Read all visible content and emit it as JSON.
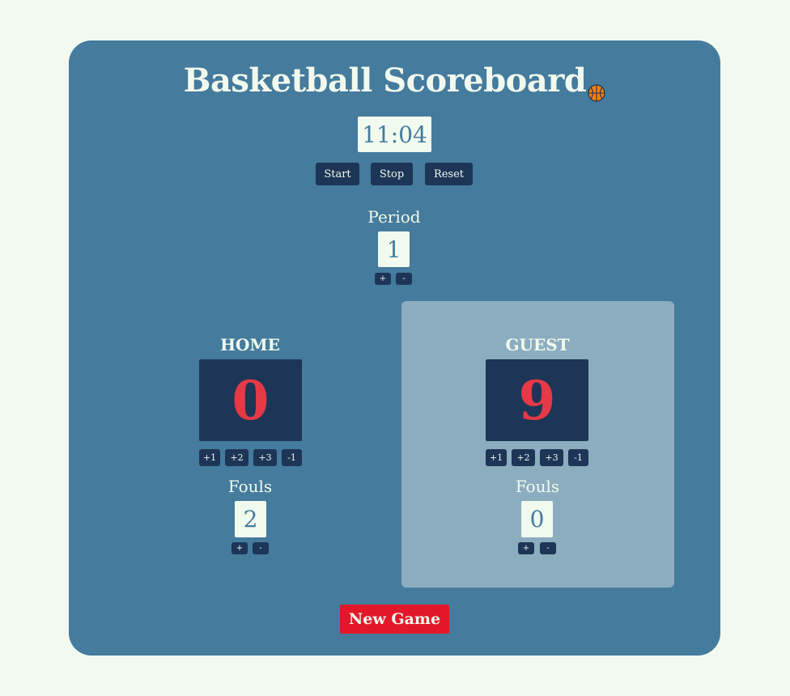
{
  "title": "Basketball Scoreboard",
  "icons": {
    "title_icon": "basketball-icon"
  },
  "colors": {
    "background": "#f1f9f0",
    "board": "#457b9d",
    "dark": "#1d3557",
    "score_red": "#e63946",
    "light": "#f1faee",
    "guest_highlight": "#8badbf",
    "new_game": "#e2182a",
    "ball": "#f77f00"
  },
  "clock": {
    "time": "11:04",
    "start_label": "Start",
    "stop_label": "Stop",
    "reset_label": "Reset"
  },
  "period": {
    "label": "Period",
    "value": "1",
    "inc_label": "+",
    "dec_label": "-"
  },
  "home": {
    "name": "HOME",
    "score": "0",
    "buttons": [
      "+1",
      "+2",
      "+3",
      "-1"
    ],
    "fouls_label": "Fouls",
    "fouls": "2",
    "fouls_inc": "+",
    "fouls_dec": "-"
  },
  "guest": {
    "name": "GUEST",
    "score": "9",
    "buttons": [
      "+1",
      "+2",
      "+3",
      "-1"
    ],
    "fouls_label": "Fouls",
    "fouls": "0",
    "fouls_inc": "+",
    "fouls_dec": "-",
    "leading": true
  },
  "new_game_label": "New Game"
}
